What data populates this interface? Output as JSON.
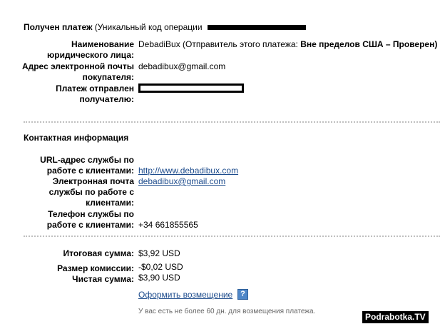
{
  "header": {
    "title_bold": "Получен платеж",
    "title_rest": " (Уникальный код операции"
  },
  "payment": {
    "legal_name_label": [
      "Наименование",
      "юридического лица:"
    ],
    "legal_name_value": "DebadiBux (Отправитель этого платежа: ",
    "legal_name_status": "Вне пределов США – Проверен)",
    "buyer_email_label": [
      "Адрес электронной почты",
      "покупателя:"
    ],
    "buyer_email_value": "debadibux@gmail.com",
    "sent_to_label": [
      "Платеж отправлен",
      "получателю:"
    ]
  },
  "contact": {
    "heading": "Контактная информация",
    "service_url_label": [
      "URL-адрес службы по",
      "работе с клиентами:"
    ],
    "service_url_value": "http://www.debadibux.com",
    "service_email_label": [
      "Электронная почта",
      "службы по работе с",
      "клиентами:"
    ],
    "service_email_value": "debadibux@gmail.com",
    "service_phone_label": [
      "Телефон службы по",
      "работе с клиентами:"
    ],
    "service_phone_value": "+34 661855565"
  },
  "totals": {
    "total_label": "Итоговая сумма:",
    "total_value": "$3,92 USD",
    "fee_label": "Размер комиссии:",
    "fee_value": "-$0,02 USD",
    "net_label": "Чистая сумма:",
    "net_value": "$3,90 USD"
  },
  "refund": {
    "link_label": "Оформить возмещение",
    "help_glyph": "?",
    "note": "У вас есть не более 60 дн. для возмещения платежа."
  },
  "watermark": "Podrabotka.TV"
}
